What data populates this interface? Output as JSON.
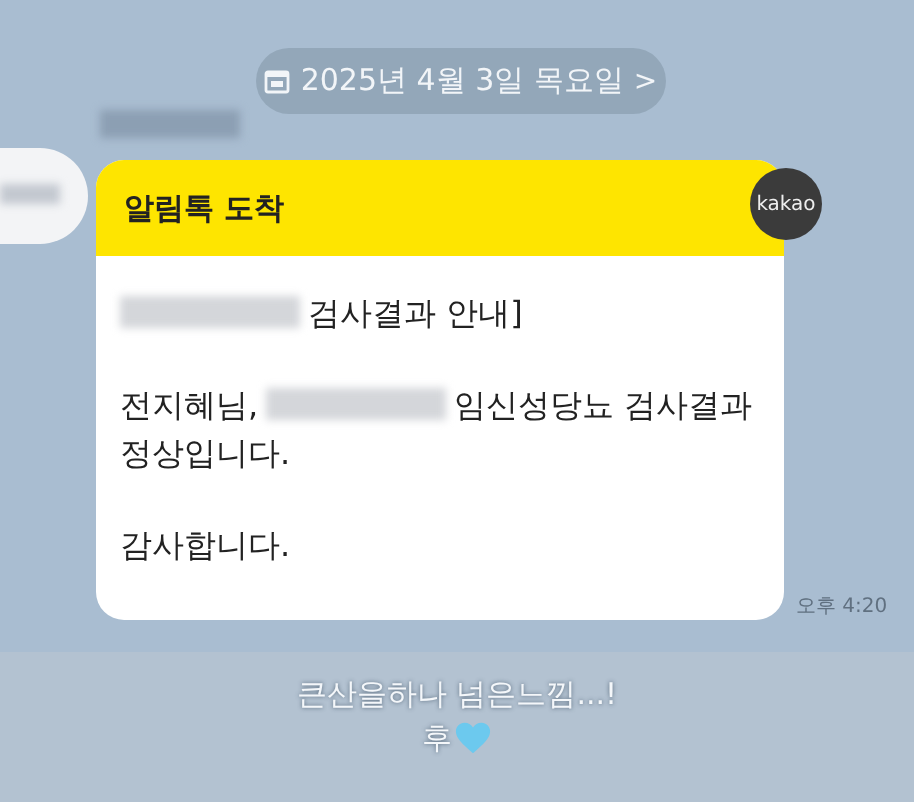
{
  "date_chip": {
    "label": "2025년 4월 3일 목요일",
    "arrow": ">"
  },
  "message": {
    "badge": "kakao",
    "header": "알림톡 도착",
    "time": "오후 4:20",
    "paragraphs": [
      [
        [
          {
            "kind": "redacted"
          },
          {
            "kind": "text",
            "text": "검사결과 안내]"
          }
        ]
      ],
      [
        [
          {
            "kind": "text",
            "text": "전지혜님,"
          },
          {
            "kind": "redacted"
          },
          {
            "kind": "text",
            "text": "임신성당뇨 검사결과"
          }
        ],
        [
          {
            "kind": "text",
            "text": "정상입니다."
          }
        ]
      ],
      [
        [
          {
            "kind": "text",
            "text": "감사합니다."
          }
        ]
      ]
    ]
  },
  "caption": {
    "lines": [
      {
        "text": "큰산을하나 넘은느낌...!",
        "heart": false
      },
      {
        "text": "후",
        "heart": true
      }
    ]
  }
}
